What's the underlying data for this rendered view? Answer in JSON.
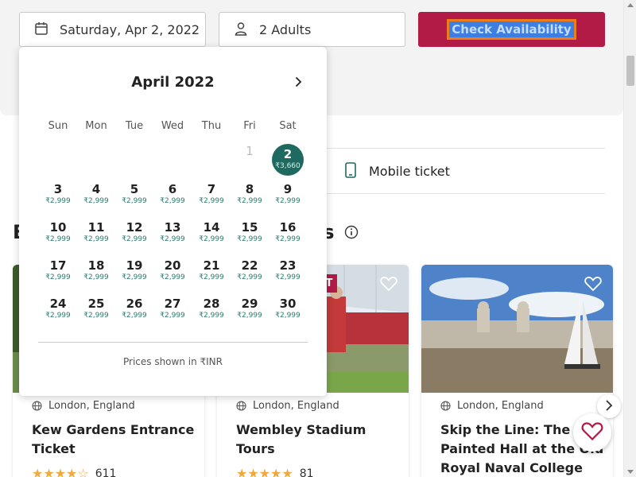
{
  "booking": {
    "date_value": "Saturday, Apr 2, 2022",
    "guests_value": "2 Adults",
    "check_label": "Check Availability"
  },
  "feature": {
    "mobile_ticket": "Mobile ticket"
  },
  "section": {
    "heading_start": "B",
    "heading_end": "es"
  },
  "calendar": {
    "month_label": "April 2022",
    "weekdays": [
      "Sun",
      "Mon",
      "Tue",
      "Wed",
      "Thu",
      "Fri",
      "Sat"
    ],
    "weeks": [
      [
        null,
        null,
        null,
        null,
        null,
        {
          "day": "1",
          "price": "",
          "state": "disabled"
        },
        {
          "day": "2",
          "price": "₹3,660",
          "state": "selected"
        }
      ],
      [
        {
          "day": "3",
          "price": "₹2,999"
        },
        {
          "day": "4",
          "price": "₹2,999"
        },
        {
          "day": "5",
          "price": "₹2,999"
        },
        {
          "day": "6",
          "price": "₹2,999"
        },
        {
          "day": "7",
          "price": "₹2,999"
        },
        {
          "day": "8",
          "price": "₹2,999"
        },
        {
          "day": "9",
          "price": "₹2,999"
        }
      ],
      [
        {
          "day": "10",
          "price": "₹2,999"
        },
        {
          "day": "11",
          "price": "₹2,999"
        },
        {
          "day": "12",
          "price": "₹2,999"
        },
        {
          "day": "13",
          "price": "₹2,999"
        },
        {
          "day": "14",
          "price": "₹2,999"
        },
        {
          "day": "15",
          "price": "₹2,999"
        },
        {
          "day": "16",
          "price": "₹2,999"
        }
      ],
      [
        {
          "day": "17",
          "price": "₹2,999"
        },
        {
          "day": "18",
          "price": "₹2,999"
        },
        {
          "day": "19",
          "price": "₹2,999"
        },
        {
          "day": "20",
          "price": "₹2,999"
        },
        {
          "day": "21",
          "price": "₹2,999"
        },
        {
          "day": "22",
          "price": "₹2,999"
        },
        {
          "day": "23",
          "price": "₹2,999"
        }
      ],
      [
        {
          "day": "24",
          "price": "₹2,999"
        },
        {
          "day": "25",
          "price": "₹2,999"
        },
        {
          "day": "26",
          "price": "₹2,999"
        },
        {
          "day": "27",
          "price": "₹2,999"
        },
        {
          "day": "28",
          "price": "₹2,999"
        },
        {
          "day": "29",
          "price": "₹2,999"
        },
        {
          "day": "30",
          "price": "₹2,999"
        }
      ]
    ],
    "note": "Prices shown in ₹INR"
  },
  "cards": [
    {
      "location": "London, England",
      "title": "Kew Gardens Entrance Ticket",
      "stars": "★★★★☆",
      "reviews": "611"
    },
    {
      "location": "London, England",
      "title": "Wembley Stadium Tours",
      "stars": "★★★★★",
      "reviews": "81",
      "badge": "UT"
    },
    {
      "location": "London, England",
      "title": "Skip the Line: The Painted Hall at the Old Royal Naval College",
      "stars": "",
      "reviews": ""
    }
  ],
  "colors": {
    "brand": "#b31b47",
    "selected_day": "#1f6a60",
    "price_text": "#2a7a6e",
    "stars": "#f2a93b"
  }
}
